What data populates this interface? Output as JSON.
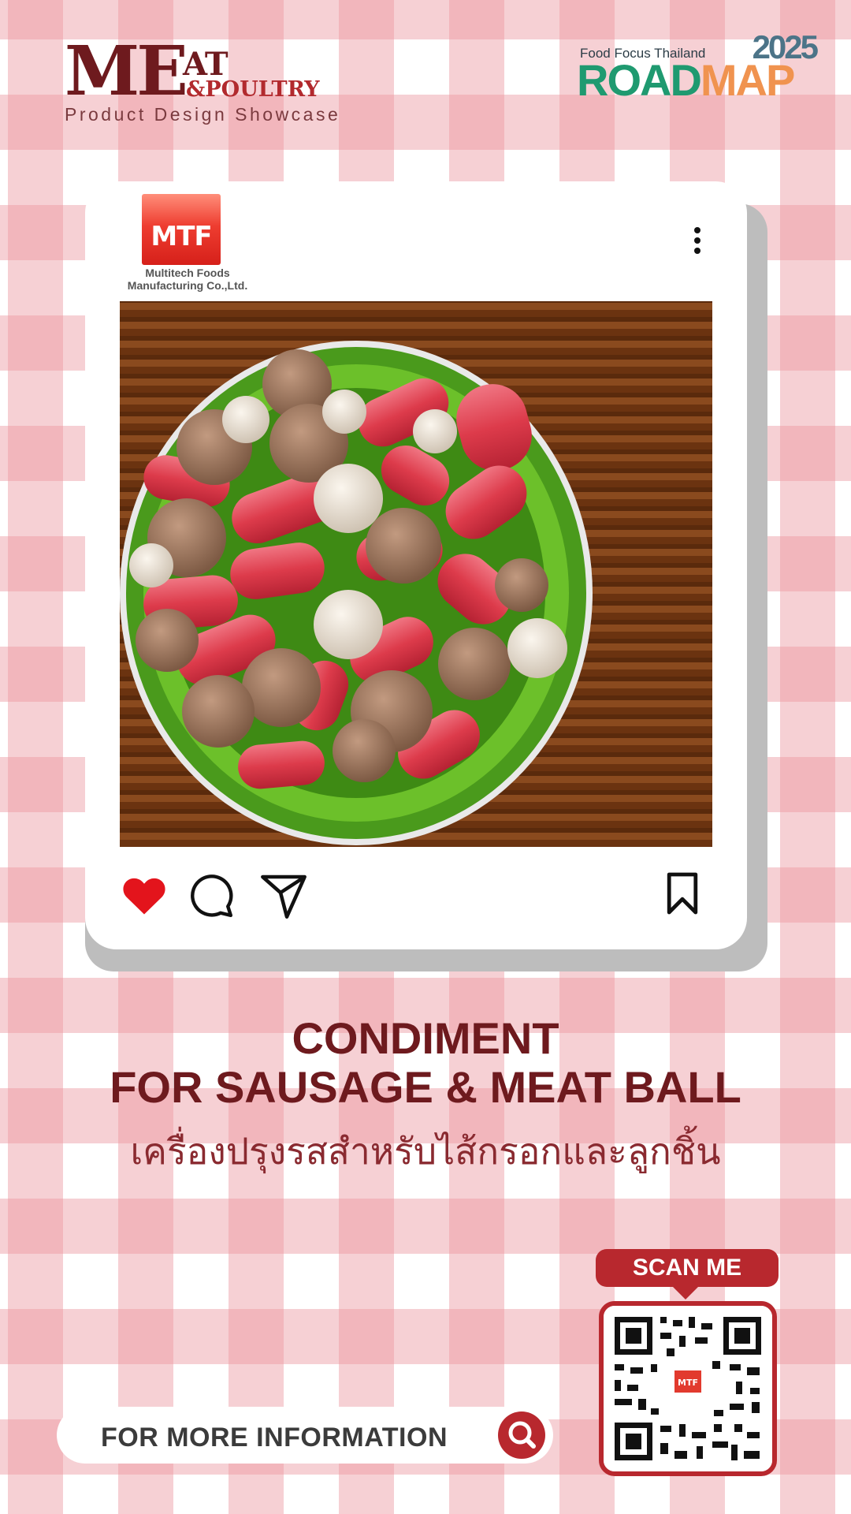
{
  "header": {
    "brand_me": "ME",
    "brand_at": "AT",
    "brand_poultry": "&POULTRY",
    "brand_tagline": "Product Design Showcase",
    "roadmap_org": "Food Focus Thailand",
    "roadmap_year": "2025",
    "roadmap_road": "ROAD",
    "roadmap_map": "MAP"
  },
  "post": {
    "logo_mark": "MTF",
    "company_line1": "Multitech Foods",
    "company_line2": "Manufacturing Co.,Ltd.",
    "menu_icon": "more-vertical-icon",
    "liked": true,
    "action_icons": [
      "heart-icon",
      "comment-icon",
      "send-icon",
      "bookmark-icon"
    ]
  },
  "title": {
    "line1": "CONDIMENT",
    "line2": "FOR SAUSAGE & MEAT BALL",
    "thai": "เครื่องปรุงรสสำหรับไส้กรอกและลูกชิ้น"
  },
  "footer": {
    "info_label": "FOR MORE INFORMATION",
    "scan_label": "SCAN ME"
  },
  "colors": {
    "brand_red": "#b8282e",
    "title_maroon": "#6e1a1e",
    "heart": "#e3141c"
  }
}
